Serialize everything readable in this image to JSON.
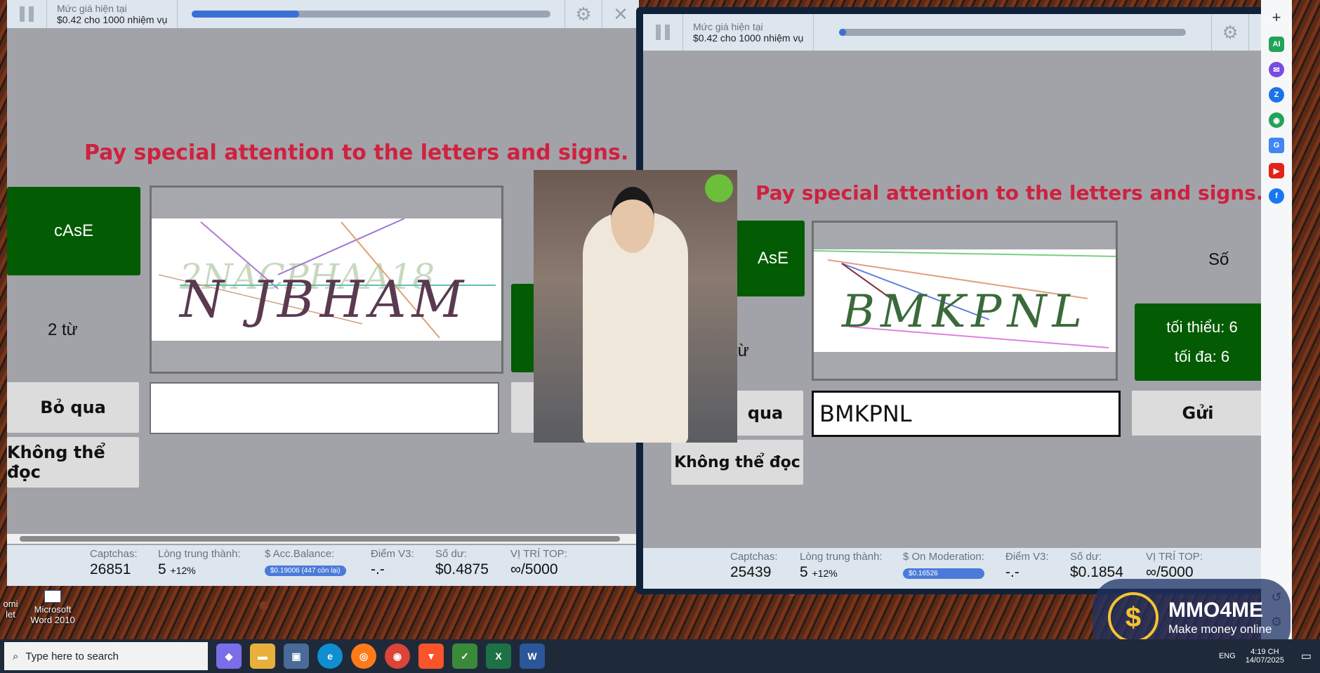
{
  "left_window": {
    "price_label": "Mức giá hiện tại",
    "price_value": "$0.42 cho 1000 nhiệm vụ",
    "progress": 0.3,
    "instruction": "Pay special attention to the letters and signs.",
    "case_label": "cAsE",
    "words_label": "2 từ",
    "skip_label": "Bỏ qua",
    "unreadable_label": "Không thể đọc",
    "captcha_text": "N JBHAM",
    "captcha_bg_text": "2NACPHAA18",
    "answer_value": "",
    "stats": {
      "captchas_label": "Captchas:",
      "captchas_value": "26851",
      "loyalty_label": "Lòng trung thành:",
      "loyalty_value": "5",
      "loyalty_pct": "+12%",
      "balance_label": "$ Acc.Balance:",
      "balance_pill": "$0.19006 (447 còn lại)",
      "score_label": "Điểm V3:",
      "score_value": "-.-",
      "remaining_label": "Số dư:",
      "remaining_value": "$0.4875",
      "top_label": "VỊ TRÍ TOP:",
      "top_value": "∞/5000"
    }
  },
  "right_window": {
    "price_label": "Mức giá hiện tại",
    "price_value": "$0.42 cho 1000 nhiệm vụ",
    "progress": 0.02,
    "instruction": "Pay special attention to the letters and signs.",
    "case_label": "AsE",
    "words_label": "từ",
    "number_label": "Số",
    "min_label": "tối thiểu: 6",
    "max_label": "tối đa: 6",
    "skip_label": "qua",
    "unreadable_label": "Không thể đọc",
    "send_label": "Gửi",
    "captcha_text": "BMKPNL",
    "answer_value": "BMKPNL",
    "stats": {
      "captchas_label": "Captchas:",
      "captchas_value": "25439",
      "loyalty_label": "Lòng trung thành:",
      "loyalty_value": "5",
      "loyalty_pct": "+12%",
      "moderation_label": "$ On Moderation:",
      "moderation_pill": "$0.16526",
      "score_label": "Điểm V3:",
      "score_value": "-.-",
      "remaining_label": "Số dư:",
      "remaining_value": "$0.1854",
      "top_label": "VỊ TRÍ TOP:",
      "top_value": "∞/5000"
    }
  },
  "desktop_icons": [
    {
      "label": "Microsoft Word 2010"
    },
    {
      "label": "omi let"
    }
  ],
  "taskbar": {
    "search_placeholder": "Type here to search",
    "lang": "ENG",
    "time": "4:19 CH",
    "date": "14/07/2025"
  },
  "watermark": {
    "brand": "MMO4ME",
    "tagline": "Make money online"
  },
  "colors": {
    "accent_red": "#cf213f",
    "green": "#035b03",
    "progress_blue": "#3b6fd6"
  }
}
